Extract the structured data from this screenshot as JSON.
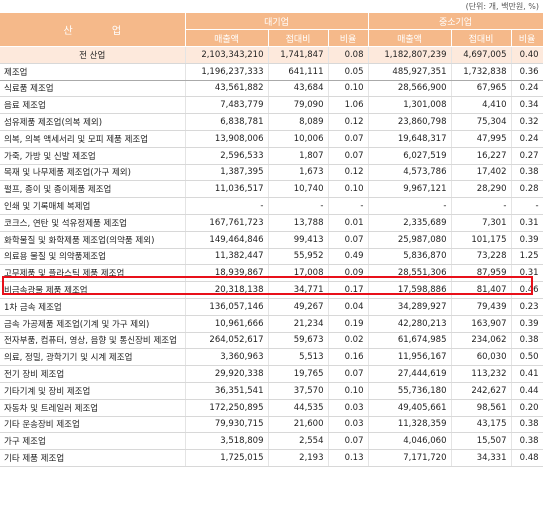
{
  "unit_note": "(단위: 개, 백만원, %)",
  "header": {
    "industry": "산 업",
    "large": "대기업",
    "sme": "중소기업",
    "sales": "매출액",
    "entertainment": "접대비",
    "ratio": "비율"
  },
  "rows": [
    {
      "name": "전 산업",
      "l_sales": "2,103,343,210",
      "l_ent": "1,741,847",
      "l_ratio": "0.08",
      "s_sales": "1,182,807,239",
      "s_ent": "4,697,005",
      "s_ratio": "0.40"
    },
    {
      "name": "제조업",
      "l_sales": "1,196,237,333",
      "l_ent": "641,111",
      "l_ratio": "0.05",
      "s_sales": "485,927,351",
      "s_ent": "1,732,838",
      "s_ratio": "0.36"
    },
    {
      "name": "식료품 제조업",
      "l_sales": "43,561,882",
      "l_ent": "43,684",
      "l_ratio": "0.10",
      "s_sales": "28,566,900",
      "s_ent": "67,965",
      "s_ratio": "0.24"
    },
    {
      "name": "음료 제조업",
      "l_sales": "7,483,779",
      "l_ent": "79,090",
      "l_ratio": "1.06",
      "s_sales": "1,301,008",
      "s_ent": "4,410",
      "s_ratio": "0.34"
    },
    {
      "name": "섬유제품 제조업(의복 제외)",
      "l_sales": "6,838,781",
      "l_ent": "8,089",
      "l_ratio": "0.12",
      "s_sales": "23,860,798",
      "s_ent": "75,304",
      "s_ratio": "0.32"
    },
    {
      "name": "의복, 의복 액세서리 및 모피 제품 제조업",
      "l_sales": "13,908,006",
      "l_ent": "10,006",
      "l_ratio": "0.07",
      "s_sales": "19,648,317",
      "s_ent": "47,995",
      "s_ratio": "0.24"
    },
    {
      "name": "가죽, 가방 및 신발 제조업",
      "l_sales": "2,596,533",
      "l_ent": "1,807",
      "l_ratio": "0.07",
      "s_sales": "6,027,519",
      "s_ent": "16,227",
      "s_ratio": "0.27"
    },
    {
      "name": "목재 및 나무제품 제조업(가구 제외)",
      "l_sales": "1,387,395",
      "l_ent": "1,673",
      "l_ratio": "0.12",
      "s_sales": "4,573,786",
      "s_ent": "17,402",
      "s_ratio": "0.38"
    },
    {
      "name": "펄프, 종이 및 종이제품 제조업",
      "l_sales": "11,036,517",
      "l_ent": "10,740",
      "l_ratio": "0.10",
      "s_sales": "9,967,121",
      "s_ent": "28,290",
      "s_ratio": "0.28"
    },
    {
      "name": "인쇄 및 기록매체 복제업",
      "l_sales": "-",
      "l_ent": "-",
      "l_ratio": "-",
      "s_sales": "-",
      "s_ent": "-",
      "s_ratio": "-"
    },
    {
      "name": "코크스, 연탄 및 석유정제품 제조업",
      "l_sales": "167,761,723",
      "l_ent": "13,788",
      "l_ratio": "0.01",
      "s_sales": "2,335,689",
      "s_ent": "7,301",
      "s_ratio": "0.31"
    },
    {
      "name": "화학물질 및 화학제품 제조업(의약품 제외)",
      "l_sales": "149,464,846",
      "l_ent": "99,413",
      "l_ratio": "0.07",
      "s_sales": "25,987,080",
      "s_ent": "101,175",
      "s_ratio": "0.39"
    },
    {
      "name": "의료용 물질 및 의약품제조업",
      "l_sales": "11,382,447",
      "l_ent": "55,952",
      "l_ratio": "0.49",
      "s_sales": "5,836,870",
      "s_ent": "73,228",
      "s_ratio": "1.25"
    },
    {
      "name": "고무제품 및 플라스틱 제품 제조업",
      "l_sales": "18,939,867",
      "l_ent": "17,008",
      "l_ratio": "0.09",
      "s_sales": "28,551,306",
      "s_ent": "87,959",
      "s_ratio": "0.31"
    },
    {
      "name": "비금속광물 제품 제조업",
      "l_sales": "20,318,138",
      "l_ent": "34,771",
      "l_ratio": "0.17",
      "s_sales": "17,598,886",
      "s_ent": "81,407",
      "s_ratio": "0.46"
    },
    {
      "name": "1차 금속 제조업",
      "l_sales": "136,057,146",
      "l_ent": "49,267",
      "l_ratio": "0.04",
      "s_sales": "34,289,927",
      "s_ent": "79,439",
      "s_ratio": "0.23"
    },
    {
      "name": "금속 가공제품 제조업(기계 및 가구 제외)",
      "l_sales": "10,961,666",
      "l_ent": "21,234",
      "l_ratio": "0.19",
      "s_sales": "42,280,213",
      "s_ent": "163,907",
      "s_ratio": "0.39"
    },
    {
      "name": "전자부품, 컴퓨터, 영상, 음향 및 통신장비 제조업",
      "l_sales": "264,052,617",
      "l_ent": "59,673",
      "l_ratio": "0.02",
      "s_sales": "61,674,985",
      "s_ent": "234,062",
      "s_ratio": "0.38"
    },
    {
      "name": "의료, 정밀, 광학기기 및 시계 제조업",
      "l_sales": "3,360,963",
      "l_ent": "5,513",
      "l_ratio": "0.16",
      "s_sales": "11,956,167",
      "s_ent": "60,030",
      "s_ratio": "0.50"
    },
    {
      "name": "전기 장비 제조업",
      "l_sales": "29,920,338",
      "l_ent": "19,765",
      "l_ratio": "0.07",
      "s_sales": "27,444,619",
      "s_ent": "113,232",
      "s_ratio": "0.41"
    },
    {
      "name": "기타기계 및 장비 제조업",
      "l_sales": "36,351,541",
      "l_ent": "37,570",
      "l_ratio": "0.10",
      "s_sales": "55,736,180",
      "s_ent": "242,627",
      "s_ratio": "0.44"
    },
    {
      "name": "자동차 및 트레일러 제조업",
      "l_sales": "172,250,895",
      "l_ent": "44,535",
      "l_ratio": "0.03",
      "s_sales": "49,405,661",
      "s_ent": "98,561",
      "s_ratio": "0.20"
    },
    {
      "name": "기타 운송장비 제조업",
      "l_sales": "79,930,715",
      "l_ent": "21,600",
      "l_ratio": "0.03",
      "s_sales": "11,328,359",
      "s_ent": "43,175",
      "s_ratio": "0.38"
    },
    {
      "name": "가구 제조업",
      "l_sales": "3,518,809",
      "l_ent": "2,554",
      "l_ratio": "0.07",
      "s_sales": "4,046,060",
      "s_ent": "15,507",
      "s_ratio": "0.38"
    },
    {
      "name": "기타 제품 제조업",
      "l_sales": "1,725,015",
      "l_ent": "2,193",
      "l_ratio": "0.13",
      "s_sales": "7,171,720",
      "s_ent": "34,331",
      "s_ratio": "0.48"
    }
  ]
}
